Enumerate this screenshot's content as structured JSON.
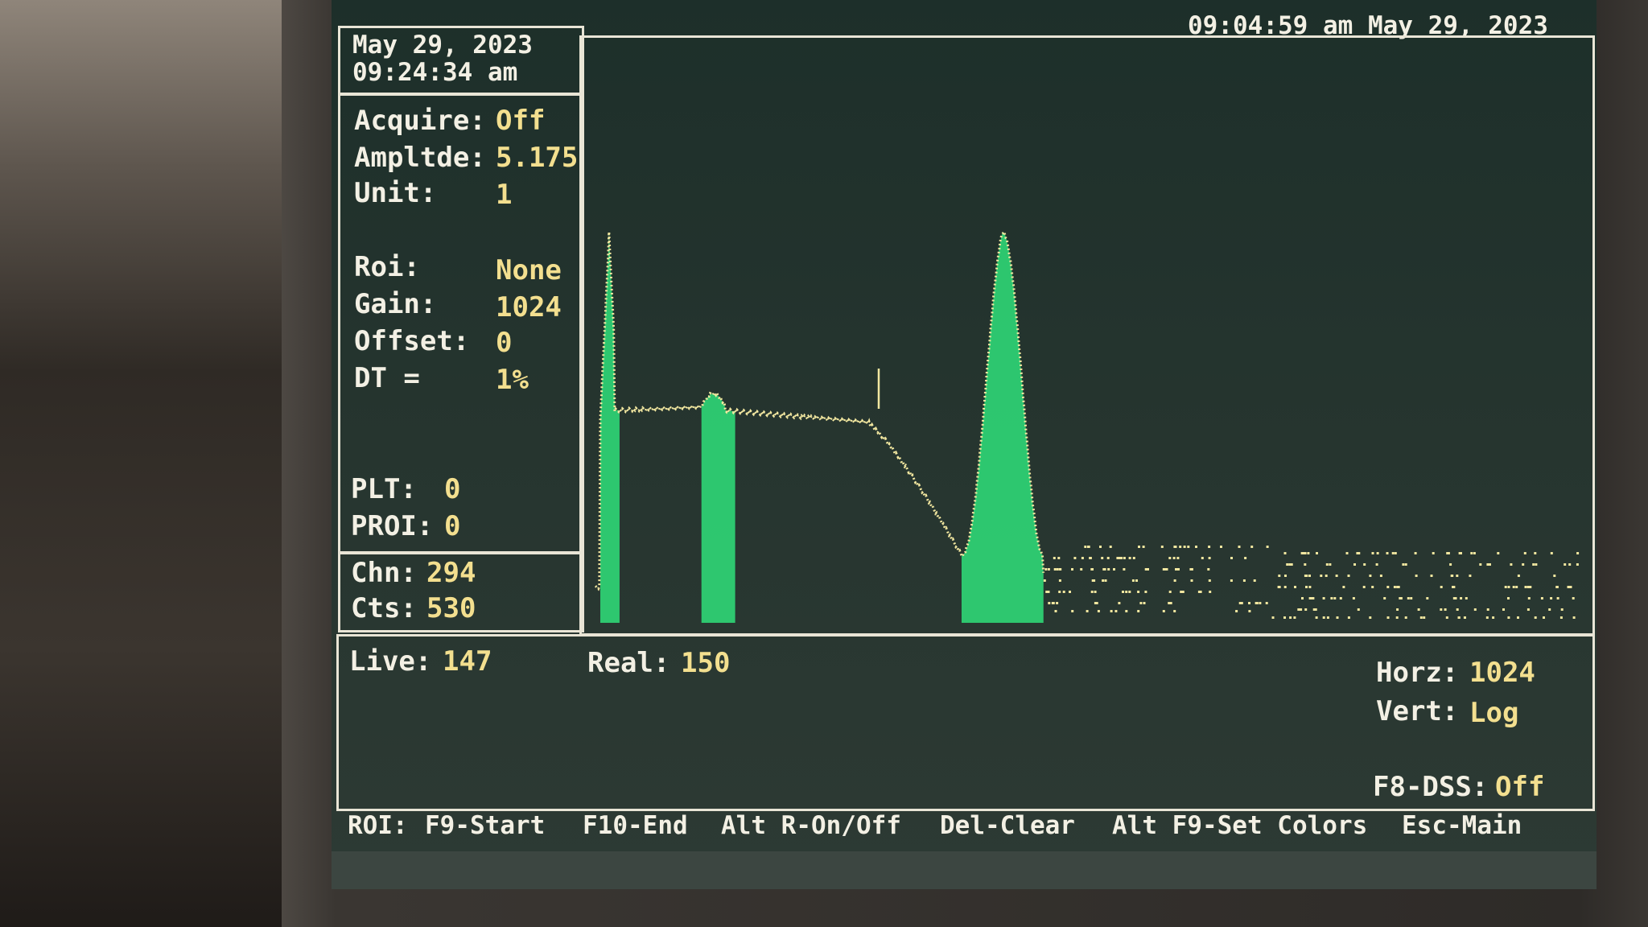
{
  "header": {
    "clock": "09:04:59 am May 29, 2023"
  },
  "datebox": {
    "date": "May 29, 2023",
    "time": "09:24:34 am"
  },
  "status": {
    "acquire_label": "Acquire:",
    "acquire_value": "Off",
    "amplitude_label": "Ampltde:",
    "amplitude_value": "5.175",
    "unit_label": "Unit:",
    "unit_value": "1",
    "roi_label": "Roi:",
    "roi_value": "None",
    "gain_label": "Gain:",
    "gain_value": "1024",
    "offset_label": "Offset:",
    "offset_value": "0",
    "dt_label": "DT =",
    "dt_value": "1%",
    "plt_label": "PLT:",
    "plt_value": "0",
    "proi_label": "PROI:",
    "proi_value": "0"
  },
  "cursor": {
    "chn_label": "Chn:",
    "chn_value": "294",
    "cts_label": "Cts:",
    "cts_value": "530"
  },
  "timing": {
    "live_label": "Live:",
    "live_value": "147",
    "real_label": "Real:",
    "real_value": "150"
  },
  "scale": {
    "horz_label": "Horz:",
    "horz_value": "1024",
    "vert_label": "Vert:",
    "vert_value": "Log",
    "dss_label": "F8-DSS:",
    "dss_value": "Off"
  },
  "menu": {
    "roi": "ROI:",
    "start": "F9-Start",
    "end": "F10-End",
    "toggle": "Alt R-On/Off",
    "clear": "Del-Clear",
    "colors": "Alt F9-Set Colors",
    "main": "Esc-Main"
  },
  "colors": {
    "roi_fill": "#2fe07a",
    "trace": "#f2e7a0",
    "text_amber": "#f3df8f",
    "frame": "#e9e5d6"
  },
  "chart_data": {
    "type": "line",
    "x_axis": "channel",
    "xlim": [
      0,
      1024
    ],
    "yscale": "log",
    "roi_regions": [
      [
        5,
        25
      ],
      [
        110,
        145
      ],
      [
        380,
        465
      ]
    ],
    "cursor_channel": 294,
    "cursor_counts": 530
  }
}
